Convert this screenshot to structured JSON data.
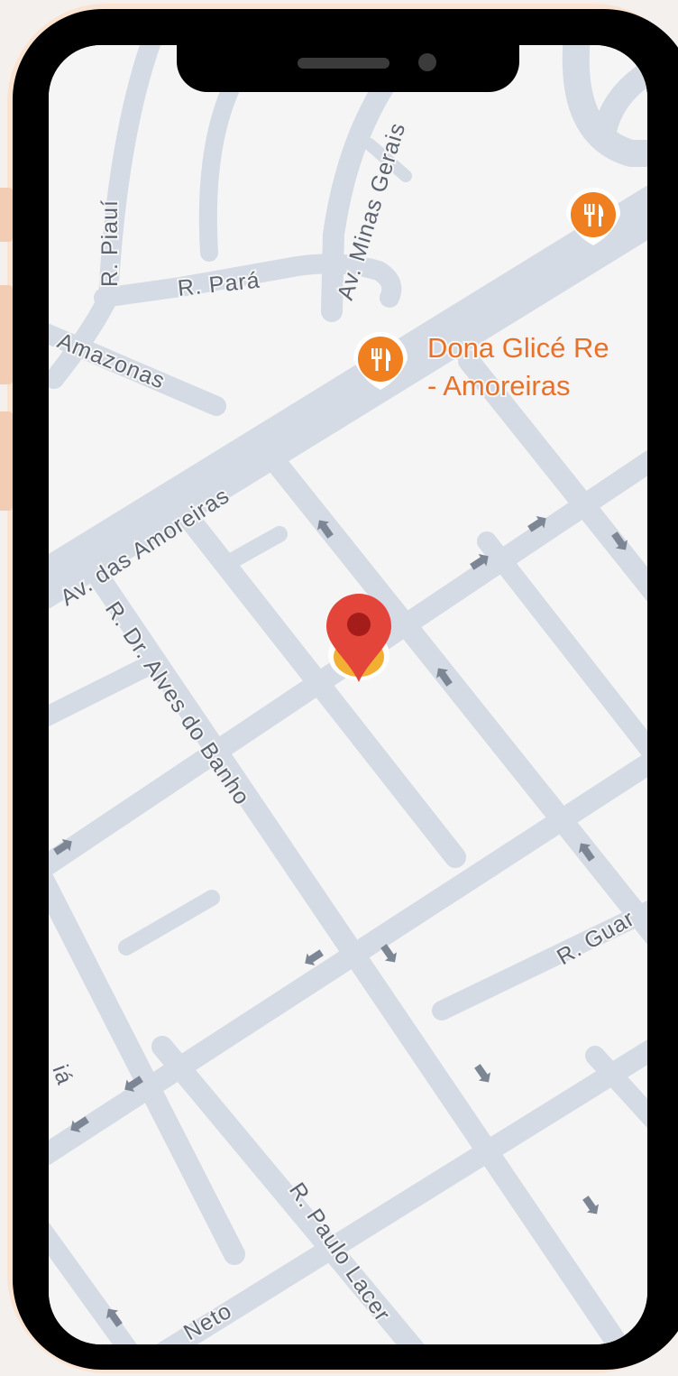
{
  "map": {
    "streets": {
      "piaui": "R. Piauí",
      "para": "R. Pará",
      "minas": "Av. Minas Gerais",
      "amazonas": "Amazonas",
      "amoreiras": "Av. das Amoreiras",
      "alves_do_banho": "R. Dr. Alves do Banho",
      "guar": "R. Guar",
      "paulo_lacer": "R. Paulo Lacer",
      "neto": "Neto",
      "ia": "iá"
    },
    "poi": {
      "dona_glice_line1": "Dona Glicé Re",
      "dona_glice_line2": "- Amoreiras"
    },
    "colors": {
      "road": "#d5dbe4",
      "poi_orange": "#f07f1f",
      "pin_red": "#e3453a",
      "pin_dark": "#a51d1a",
      "pin_base": "#f2b033"
    },
    "icons": [
      "restaurant-icon",
      "location-pin-icon",
      "arrow-icon"
    ]
  }
}
